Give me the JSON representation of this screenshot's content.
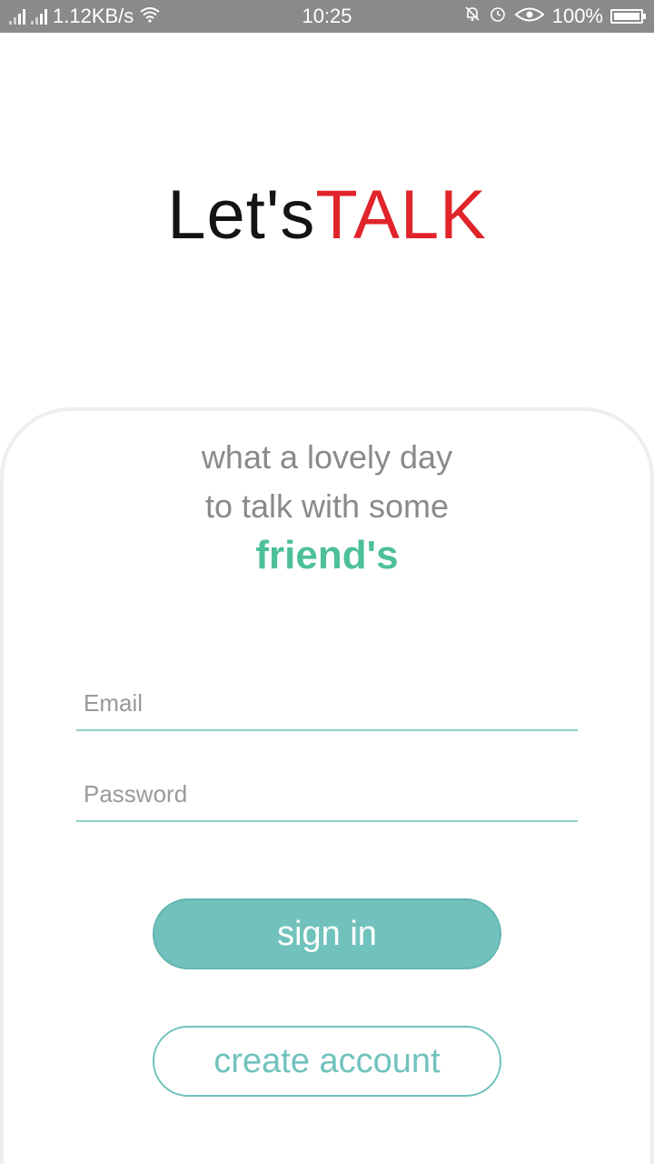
{
  "status_bar": {
    "network_speed": "1.12KB/s",
    "time": "10:25",
    "battery": "100%",
    "icons": [
      "signal-icon",
      "wifi-icon",
      "mute-icon",
      "alarm-icon",
      "eye-icon",
      "battery-icon"
    ]
  },
  "logo": {
    "part1": "Let's",
    "part2": "TALK"
  },
  "tagline": {
    "line1": "what a lovely day",
    "line2": "to talk with some",
    "highlight": "friend's"
  },
  "form": {
    "email_placeholder": "Email",
    "password_placeholder": "Password",
    "email_value": "",
    "password_value": ""
  },
  "buttons": {
    "sign_in": "sign in",
    "create_account": "create account"
  },
  "colors": {
    "accent": "#71c2bd",
    "highlight": "#4dbf9a",
    "logo_red": "#e0242a",
    "status_bar": "#8a8a8a"
  }
}
